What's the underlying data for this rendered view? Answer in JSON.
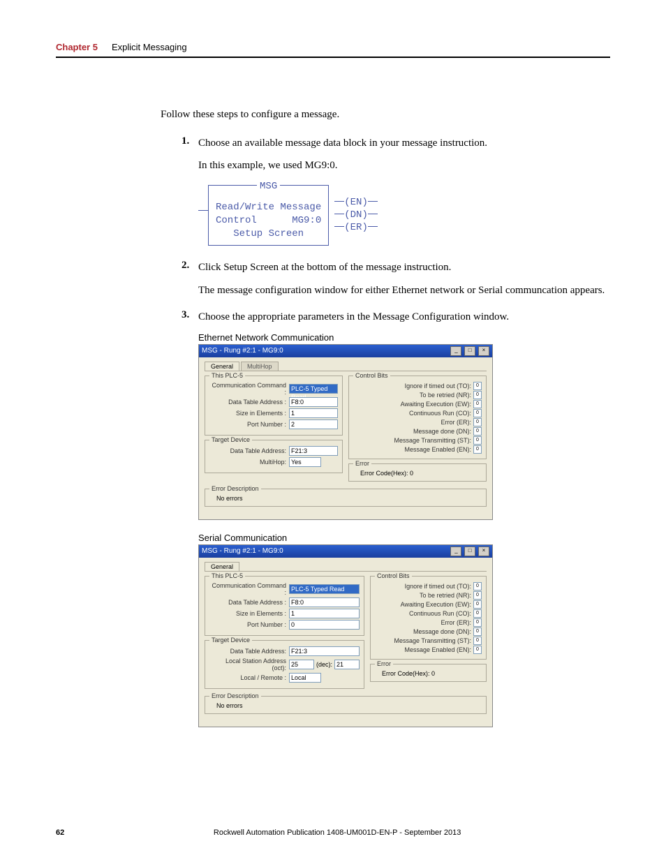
{
  "header": {
    "chapter_label": "Chapter 5",
    "chapter_title": "Explicit Messaging"
  },
  "intro": "Follow these steps to configure a message.",
  "steps": {
    "s1_num": "1.",
    "s1_text": "Choose an available message data block in your message instruction.",
    "s1_sub": "In this example, we used MG9:0.",
    "s2_num": "2.",
    "s2_text": "Click Setup Screen at the bottom of the message instruction.",
    "s2_sub": "The message configuration window for either Ethernet network or Serial communcation appears.",
    "s3_num": "3.",
    "s3_text": "Choose the appropriate parameters in the Message Configuration window."
  },
  "ladder": {
    "title": "MSG",
    "line1": "Read/Write Message",
    "ctrl_label": "Control",
    "ctrl_value": "MG9:0",
    "setup": "Setup Screen",
    "coil1": "EN",
    "coil2": "DN",
    "coil3": "ER"
  },
  "eth_caption": "Ethernet Network Communication",
  "serial_caption": "Serial Communication",
  "dlg": {
    "title": "MSG - Rung #2:1 - MG9:0",
    "tab_general": "General",
    "tab_multihop": "MultiHop",
    "fs_thisplc": "This PLC-5",
    "l_commcmd": "Communication Command :",
    "v_commcmd": "PLC-5 Typed Read",
    "l_dtaddr": "Data Table Address :",
    "v_dtaddr": "F8:0",
    "l_size": "Size in Elements :",
    "v_size": "1",
    "l_port": "Port Number :",
    "v_port_eth": "2",
    "v_port_ser": "0",
    "fs_target": "Target Device",
    "l_tgt_addr": "Data Table Address:",
    "v_tgt_addr": "F21:3",
    "l_multihop": "MultiHop:",
    "v_multihop": "Yes",
    "l_local_oct": "Local Station Address (oct):",
    "v_local_oct": "25",
    "l_dec": "(dec):",
    "v_dec": "21",
    "l_localremote": "Local / Remote :",
    "v_localremote": "Local",
    "fs_ctrlbits": "Control Bits",
    "cb_to": "Ignore if timed out (TO):",
    "cb_nr": "To be retried (NR):",
    "cb_ew": "Awaiting Execution (EW):",
    "cb_co": "Continuous Run (CO):",
    "cb_er": "Error (ER):",
    "cb_dn": "Message done (DN):",
    "cb_st": "Message Transmitting (ST):",
    "cb_en": "Message Enabled (EN):",
    "v0": "0",
    "fs_error": "Error",
    "err_code": "Error Code(Hex):  0",
    "fs_errdesc": "Error Description",
    "no_errors": "No errors"
  },
  "footer": {
    "page": "62",
    "pub": "Rockwell Automation Publication 1408-UM001D-EN-P - September 2013"
  }
}
